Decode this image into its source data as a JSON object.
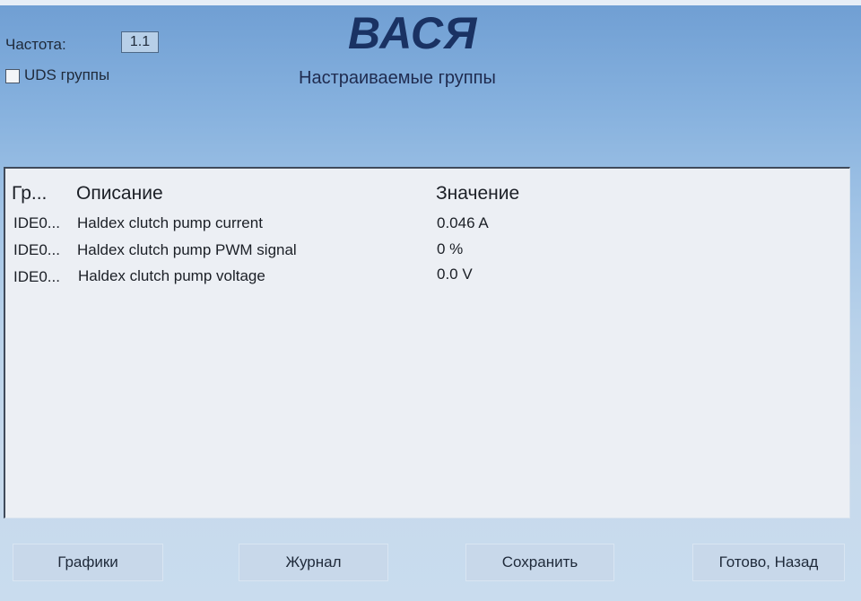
{
  "app": {
    "title": "ВАСЯ",
    "subtitle": "Настраиваемые группы"
  },
  "controls": {
    "frequency_label": "Частота:",
    "frequency_value": "1.1",
    "uds_groups_label": "UDS группы",
    "uds_groups_checked": false
  },
  "table": {
    "headers": {
      "group": "Гр...",
      "description": "Описание",
      "value": "Значение"
    },
    "rows": [
      {
        "group": "IDE0...",
        "description": "Haldex clutch pump current",
        "value": "0.046 A"
      },
      {
        "group": "IDE0...",
        "description": "Haldex clutch pump PWM signal",
        "value": "0 %"
      },
      {
        "group": "IDE0...",
        "description": "Haldex clutch pump voltage",
        "value": "0.0 V"
      }
    ]
  },
  "buttons": {
    "graphs": "Графики",
    "log": "Журнал",
    "save": "Сохранить",
    "done_back": "Готово, Назад"
  }
}
